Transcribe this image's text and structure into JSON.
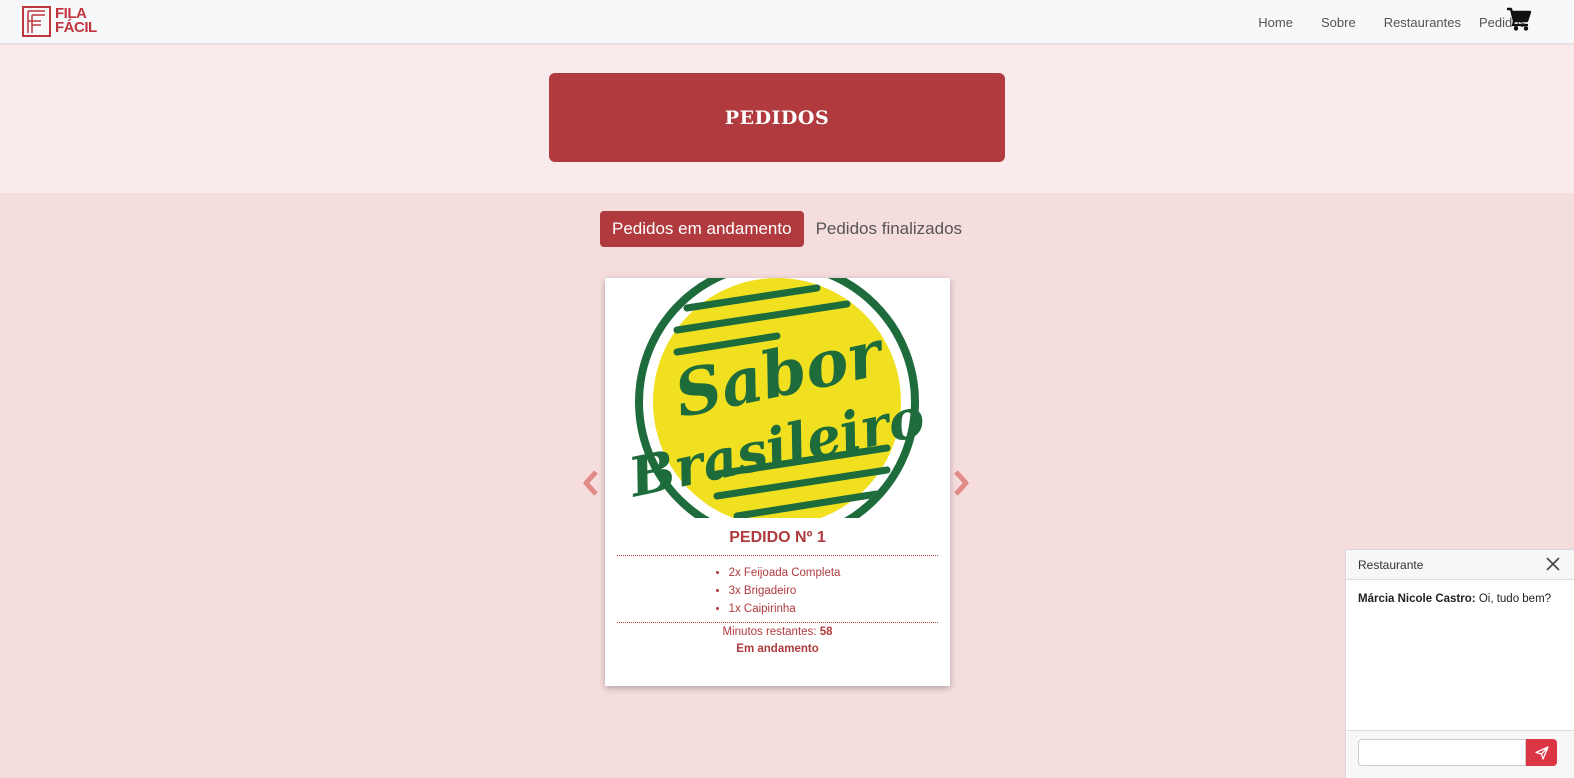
{
  "brand": {
    "line1": "FILA",
    "line2": "FÁCIL"
  },
  "nav": {
    "items": [
      "Home",
      "Sobre",
      "Restaurantes",
      "Pedidos"
    ]
  },
  "hero": {
    "title": "PEDIDOS"
  },
  "tabs": [
    {
      "label": "Pedidos em andamento",
      "active": true
    },
    {
      "label": "Pedidos finalizados",
      "active": false
    }
  ],
  "order": {
    "image_text_line1": "Sabor",
    "image_text_line2": "Brasileiro",
    "title": "PEDIDO Nº 1",
    "items": [
      "2x Feijoada Completa",
      "3x Brigadeiro",
      "1x Caipirinha"
    ],
    "remaining_label": "Minutos restantes:",
    "remaining_value": "58",
    "status": "Em andamento"
  },
  "chat": {
    "title": "Restaurante",
    "messages": [
      {
        "author": "Márcia Nicole Castro:",
        "text": "Oi, tudo bem?"
      }
    ],
    "input_value": ""
  },
  "colors": {
    "primary": "#b03a3d",
    "send": "#dc3545",
    "page_bg": "#f5dcdd",
    "hero_bg": "#f9ebeb",
    "logo_green": "#1e6b3c",
    "logo_yellow": "#f0e020"
  },
  "icons": [
    "cart-icon",
    "chevron-left-icon",
    "chevron-right-icon",
    "close-icon",
    "send-icon"
  ]
}
